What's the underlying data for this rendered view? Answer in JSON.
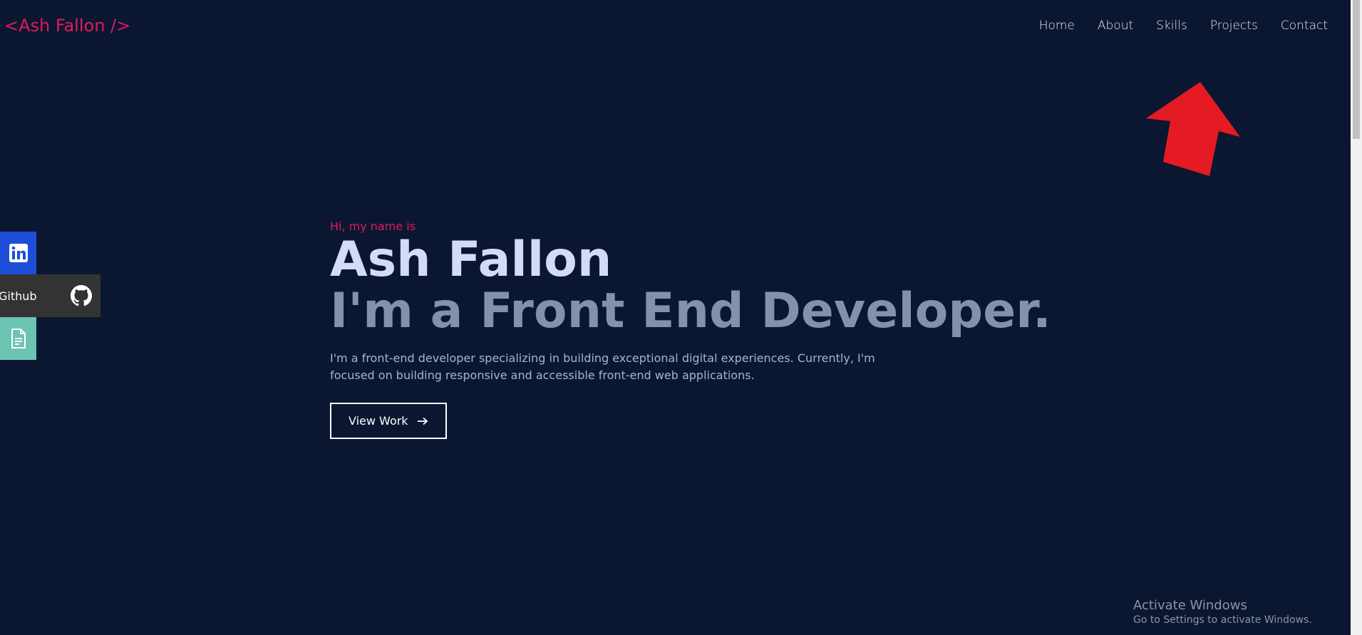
{
  "header": {
    "logo": "<Ash Fallon />",
    "nav": [
      "Home",
      "About",
      "Skills",
      "Projects",
      "Contact"
    ]
  },
  "social": {
    "github_label": "Github",
    "icons": [
      "linkedin-icon",
      "github-icon",
      "file-icon"
    ]
  },
  "hero": {
    "eyebrow": "Hi, my name is",
    "name": "Ash Fallon",
    "role": "I'm a Front End Developer.",
    "description": "I'm a front-end developer specializing in building exceptional digital experiences. Currently, I'm focused on building responsive and accessible front-end web applications.",
    "cta_label": "View Work"
  },
  "watermark": {
    "title": "Activate Windows",
    "subtitle": "Go to Settings to activate Windows."
  },
  "colors": {
    "background": "#0b1730",
    "accent": "#e0195f",
    "linkedin": "#1d4ed8",
    "github": "#333333",
    "resume": "#6cc4b3",
    "annotation_arrow": "#e51b23"
  }
}
